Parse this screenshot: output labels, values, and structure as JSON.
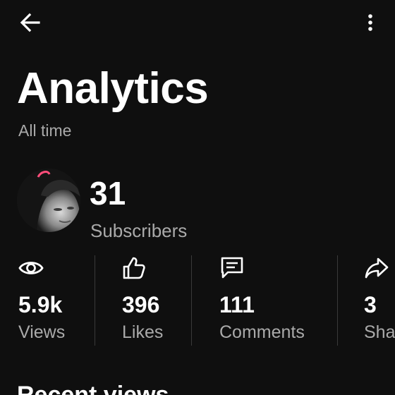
{
  "header": {
    "title": "Analytics",
    "period": "All time"
  },
  "channel": {
    "subscriber_count": "31",
    "subscriber_label": "Subscribers"
  },
  "stats": [
    {
      "icon": "eye-icon",
      "value": "5.9k",
      "label": "Views"
    },
    {
      "icon": "thumbs-up-icon",
      "value": "396",
      "label": "Likes"
    },
    {
      "icon": "comment-icon",
      "value": "111",
      "label": "Comments"
    },
    {
      "icon": "share-icon",
      "value": "3",
      "label": "Shares"
    }
  ],
  "sections": {
    "recent_views": "Recent views"
  },
  "colors": {
    "background": "#0f0f0f",
    "text_primary": "#ffffff",
    "text_secondary": "#aaaaaa",
    "divider": "#3a3a3a"
  }
}
